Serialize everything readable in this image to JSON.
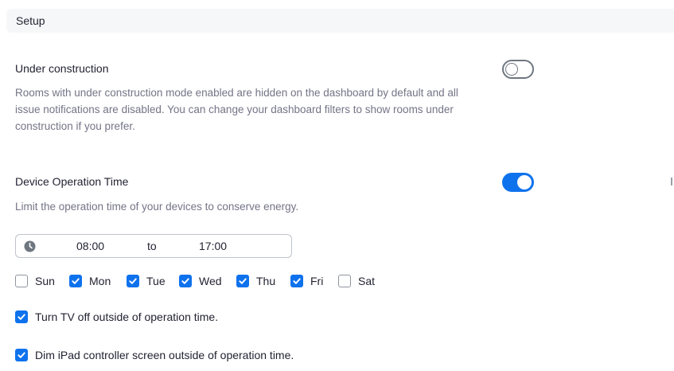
{
  "section": {
    "title": "Setup"
  },
  "under_construction": {
    "title": "Under construction",
    "description_lines": [
      "Rooms with under construction mode enabled are hidden on the dashboard by default and all",
      "issue notifications are disabled. You can change your dashboard filters to show rooms under",
      "construction if you prefer."
    ],
    "enabled": false
  },
  "device_operation_time": {
    "title": "Device Operation Time",
    "description": "Limit the operation time of your devices to conserve energy.",
    "enabled": true,
    "start_time": "08:00",
    "separator": "to",
    "end_time": "17:00",
    "days": [
      {
        "label": "Sun",
        "checked": false
      },
      {
        "label": "Mon",
        "checked": true
      },
      {
        "label": "Tue",
        "checked": true
      },
      {
        "label": "Wed",
        "checked": true
      },
      {
        "label": "Thu",
        "checked": true
      },
      {
        "label": "Fri",
        "checked": true
      },
      {
        "label": "Sat",
        "checked": false
      }
    ],
    "options": [
      {
        "label": "Turn TV off outside of operation time.",
        "checked": true
      },
      {
        "label": "Dim iPad controller screen outside of operation time.",
        "checked": true
      }
    ]
  },
  "colors": {
    "accent": "#0e72ed",
    "muted_text": "#747487",
    "header_bg": "#f6f7f9"
  },
  "icons": {
    "clock": "clock-icon",
    "check": "checkmark-icon"
  }
}
